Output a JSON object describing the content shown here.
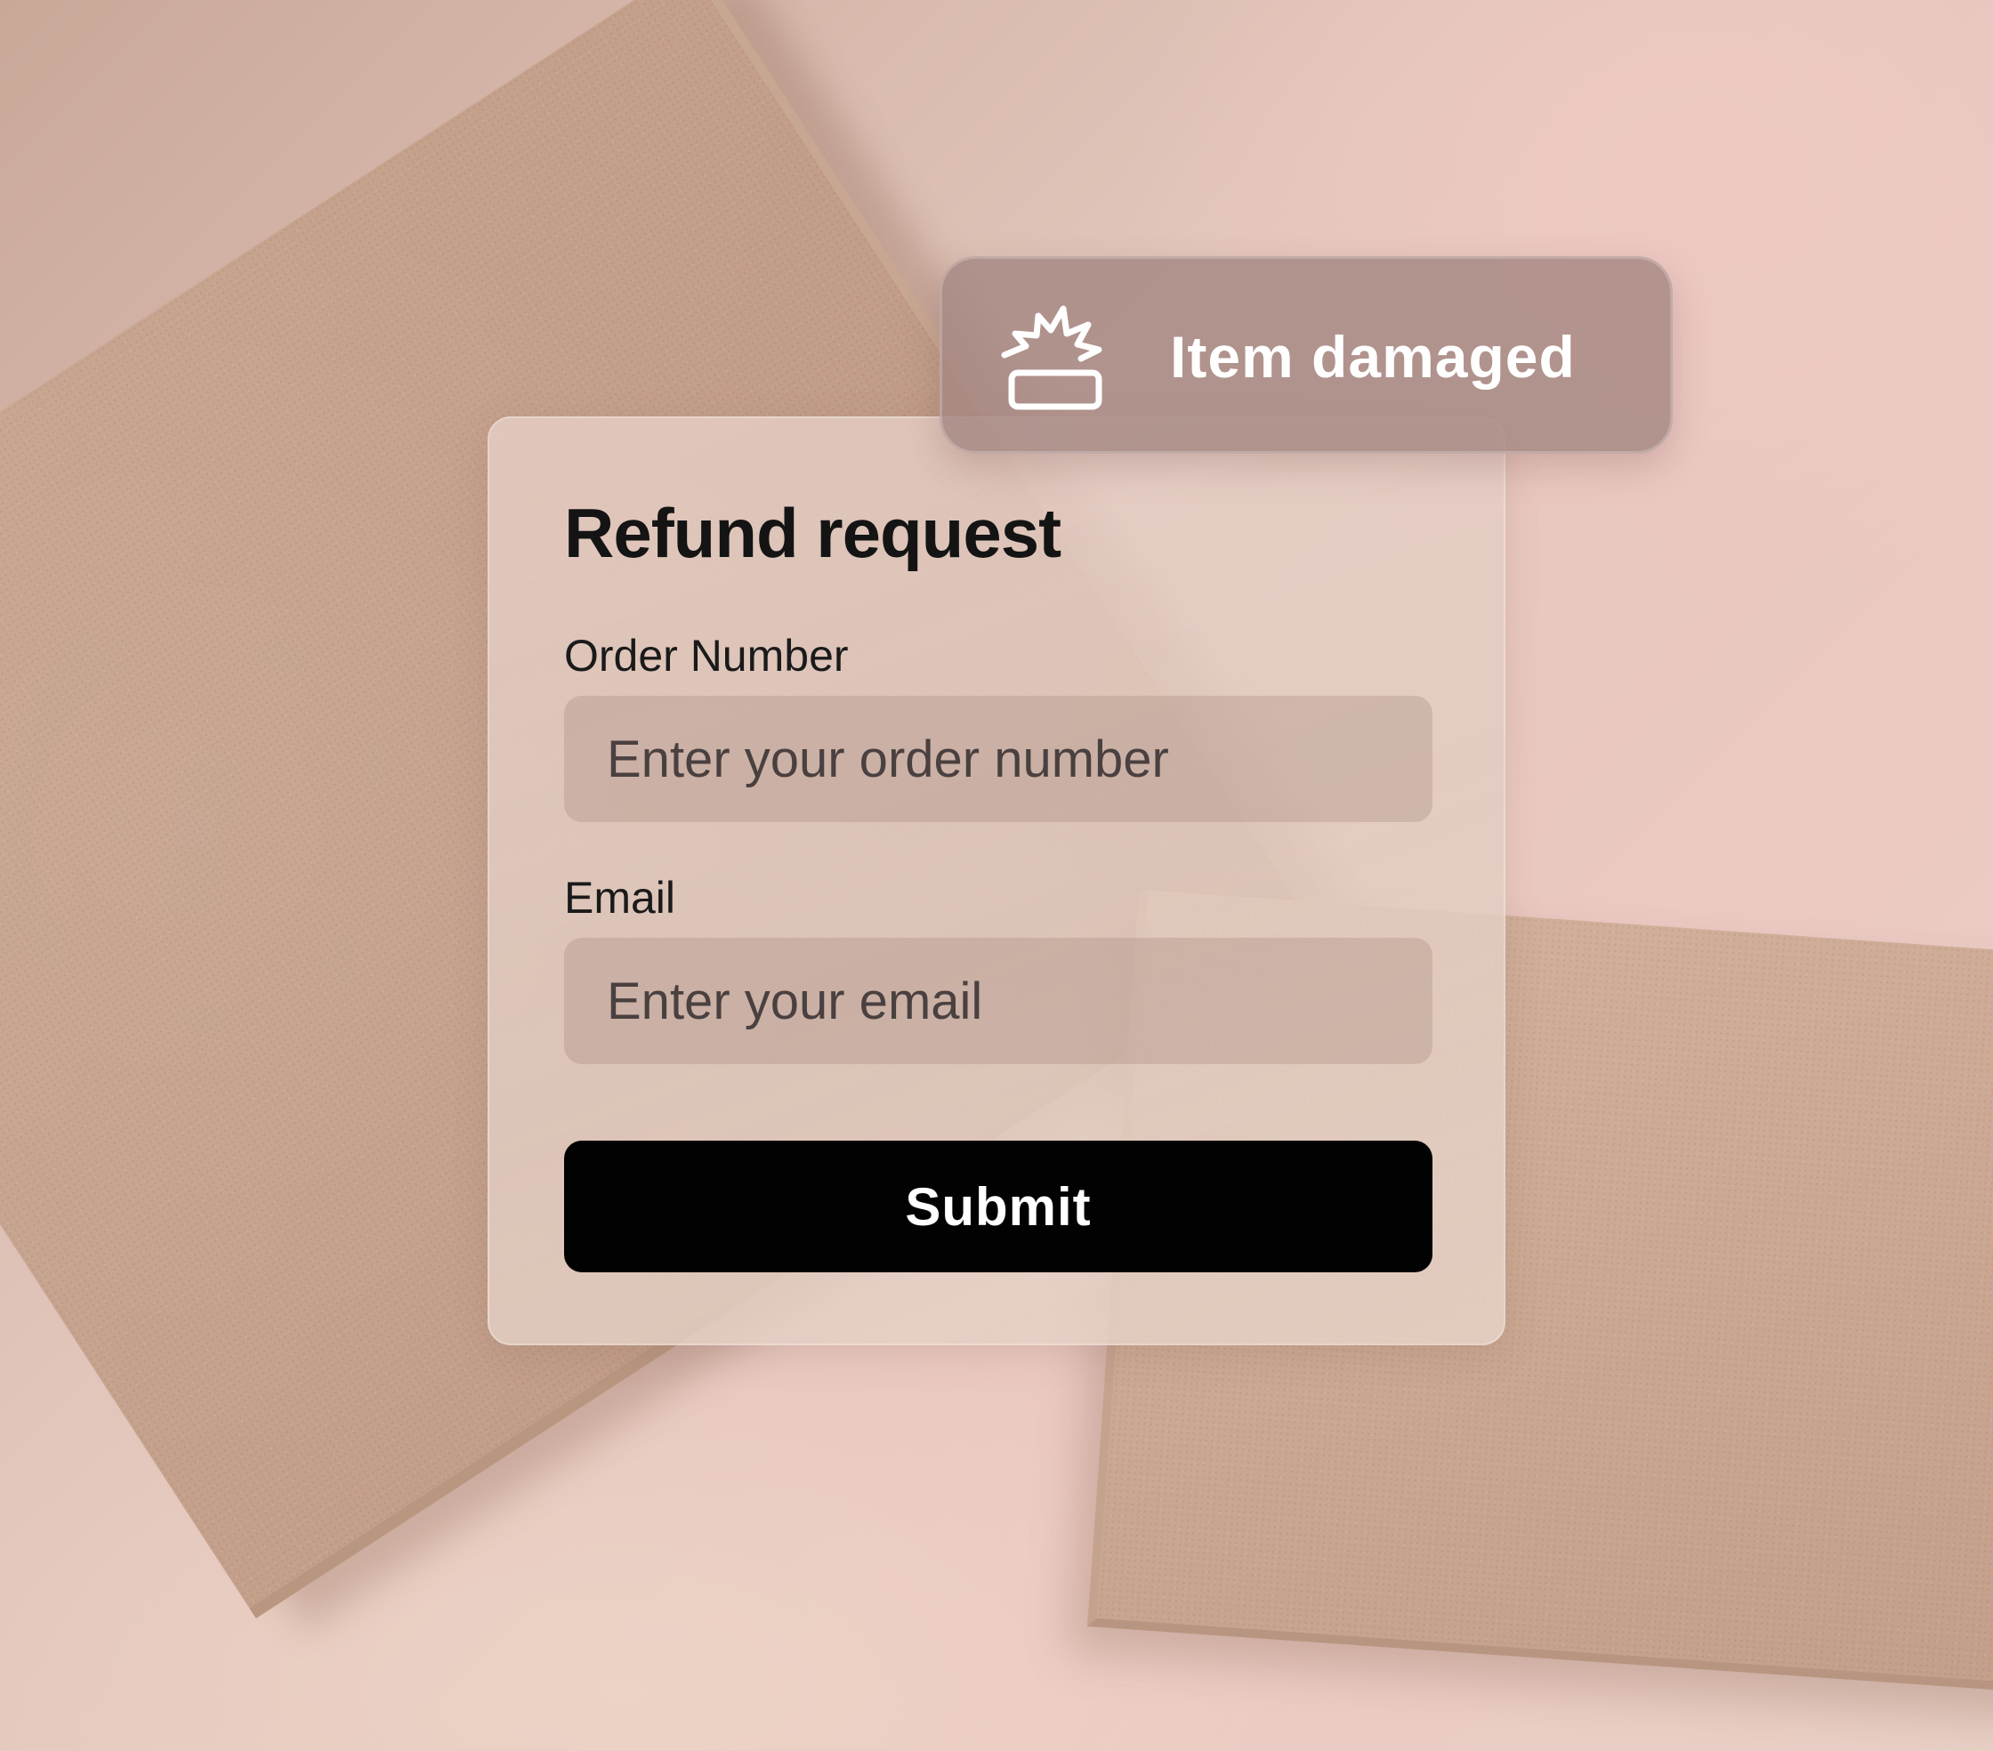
{
  "tag": {
    "label": "Item damaged",
    "icon": "damaged-box-icon"
  },
  "form": {
    "title": "Refund request",
    "fields": [
      {
        "label": "Order Number",
        "placeholder": "Enter your order number",
        "value": ""
      },
      {
        "label": "Email",
        "placeholder": "Enter your email",
        "value": ""
      }
    ],
    "submit_label": "Submit"
  },
  "colors": {
    "button_bg": "#030203",
    "button_text": "#ffffff",
    "tag_bg": "#a5877f",
    "title_text": "#141414"
  }
}
